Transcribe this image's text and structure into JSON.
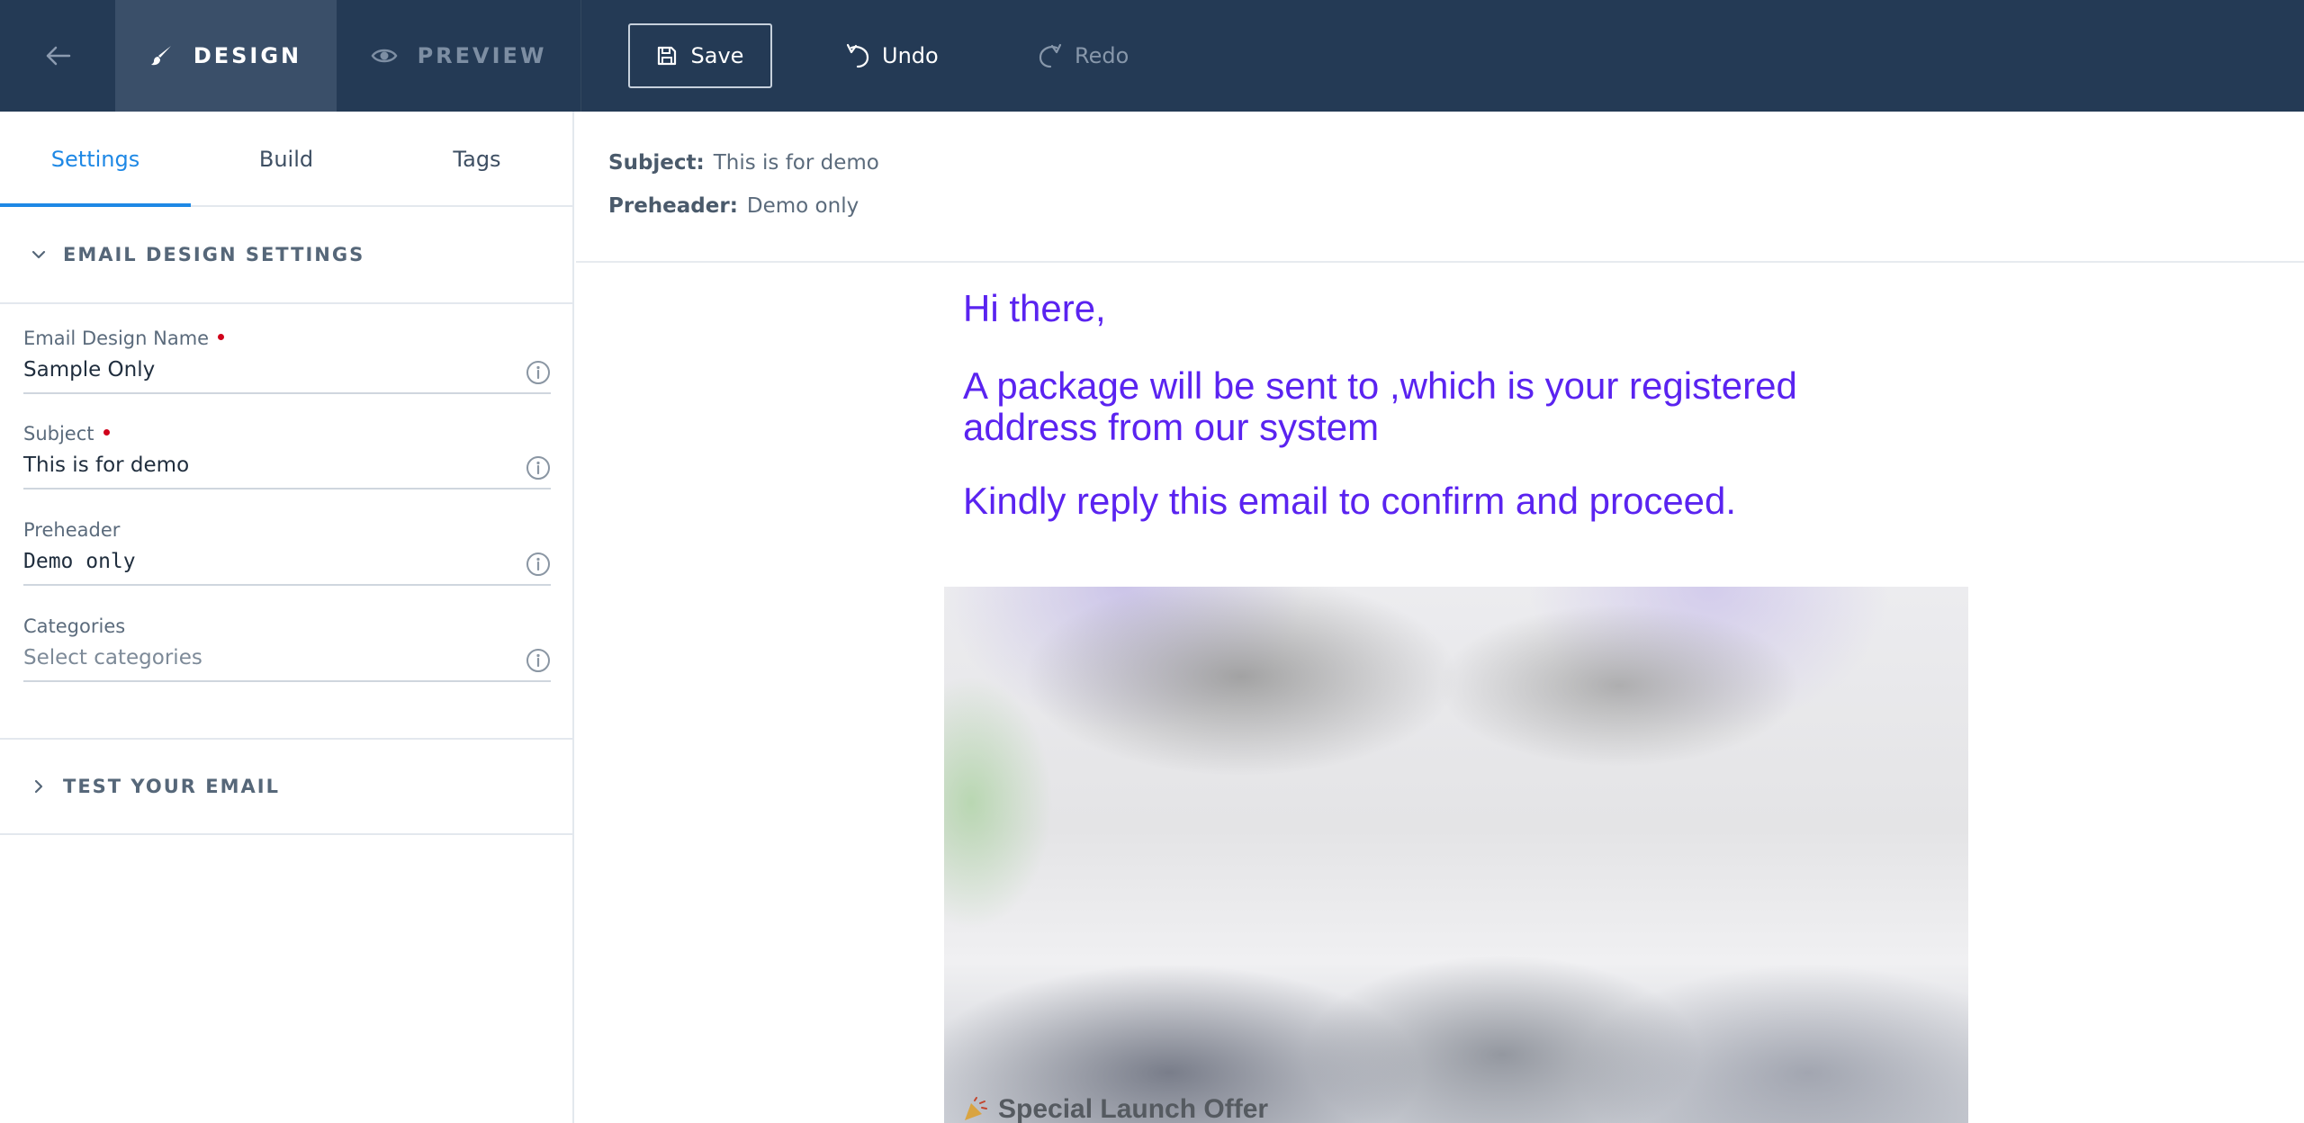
{
  "topbar": {
    "back_icon": "arrow-left-icon",
    "design_label": "DESIGN",
    "design_icon": "brush-icon",
    "preview_label": "PREVIEW",
    "preview_icon": "eye-icon",
    "save_label": "Save",
    "save_icon": "floppy-disk-icon",
    "undo_label": "Undo",
    "undo_icon": "undo-icon",
    "redo_label": "Redo",
    "redo_icon": "redo-icon"
  },
  "sidebar": {
    "tabs": [
      {
        "label": "Settings",
        "active": true
      },
      {
        "label": "Build",
        "active": false
      },
      {
        "label": "Tags",
        "active": false
      }
    ],
    "design_settings": {
      "title": "EMAIL DESIGN SETTINGS",
      "expanded": true,
      "fields": [
        {
          "label": "Email Design Name",
          "required": true,
          "value": "Sample Only",
          "placeholder": ""
        },
        {
          "label": "Subject",
          "required": true,
          "value": "This is for demo",
          "placeholder": ""
        },
        {
          "label": "Preheader",
          "required": false,
          "value": "Demo only",
          "placeholder": ""
        },
        {
          "label": "Categories",
          "required": false,
          "value": "",
          "placeholder": "Select categories"
        }
      ]
    },
    "test_email": {
      "title": "TEST YOUR EMAIL",
      "expanded": false
    }
  },
  "main": {
    "subject_key": "Subject:",
    "subject_value": "This is for demo",
    "preheader_key": "Preheader:",
    "preheader_value": "Demo only",
    "email": {
      "greeting": "Hi there,",
      "line1": "A package will be sent to ,which is your registered address from our system",
      "line2": "Kindly reply this email to confirm and proceed.",
      "banner_offer": "Special Launch Offer",
      "banner_icon": "party-popper-icon"
    }
  },
  "colors": {
    "topbar_bg": "#243a55",
    "design_tab_bg": "#3a4f69",
    "accent": "#1e88e5",
    "email_text": "#5a23f0",
    "required": "#d0021b"
  }
}
